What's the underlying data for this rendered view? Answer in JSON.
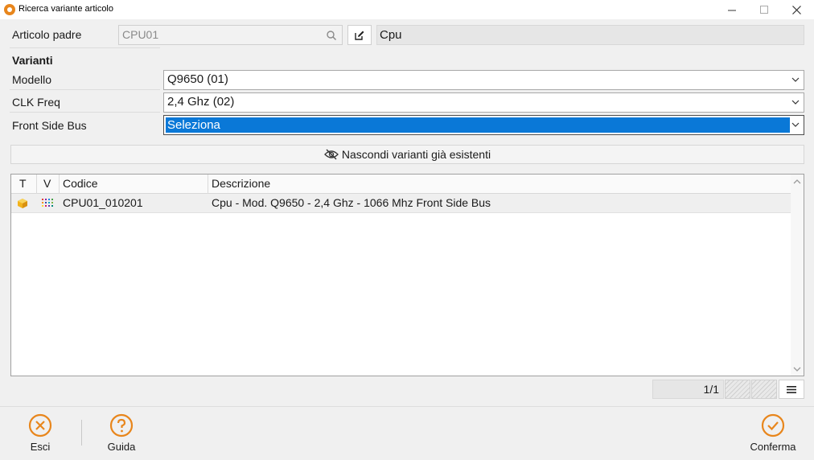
{
  "window": {
    "title": "Ricerca variante articolo",
    "icon": "app-logo-icon",
    "accent_color": "#e8861c"
  },
  "parent": {
    "label": "Articolo padre",
    "code": "CPU01",
    "description": "Cpu"
  },
  "variants": {
    "title": "Varianti",
    "fields": [
      {
        "label": "Modello",
        "value": "Q9650 (01)"
      },
      {
        "label": "CLK Freq",
        "value": "2,4 Ghz (02)"
      },
      {
        "label": "Front Side Bus",
        "value": "Seleziona"
      }
    ],
    "selection_color": "#0a78d7"
  },
  "toggle": {
    "label": "Nascondi varianti già esistenti",
    "icon": "eye-slash-icon"
  },
  "grid": {
    "columns": [
      "T",
      "V",
      "Codice",
      "Descrizione"
    ],
    "rows": [
      {
        "type_icon": "box-icon",
        "variant_icon": "color-dots-icon",
        "code": "CPU01_010201",
        "description": "Cpu - Mod. Q9650 - 2,4 Ghz - 1066 Mhz Front Side Bus"
      }
    ]
  },
  "pager": {
    "text": "1/1"
  },
  "footer": {
    "exit_label": "Esci",
    "help_label": "Guida",
    "confirm_label": "Conferma"
  }
}
